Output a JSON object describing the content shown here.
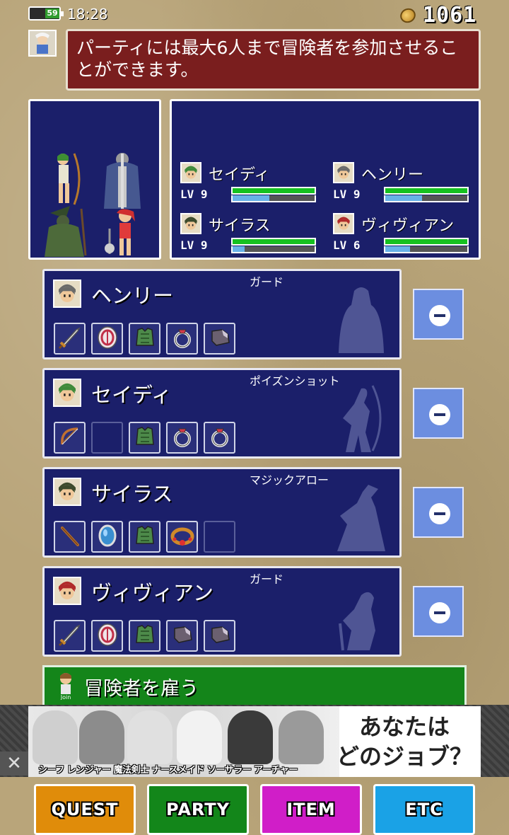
{
  "status_bar": {
    "battery": "59",
    "time": "18:28",
    "gold": "1061"
  },
  "message": "パーティには最大6人まで冒険者を参加させることができます。",
  "party_stats": [
    {
      "name": "セイディ",
      "level": "LV 9",
      "hp": 1.0,
      "exp": 0.45,
      "color": "#3f8a3a"
    },
    {
      "name": "ヘンリー",
      "level": "LV 9",
      "hp": 1.0,
      "exp": 0.45,
      "color": "#6a6a6a"
    },
    {
      "name": "サイラス",
      "level": "LV 9",
      "hp": 1.0,
      "exp": 0.15,
      "color": "#3c4a2c"
    },
    {
      "name": "ヴィヴィアン",
      "level": "LV 6",
      "hp": 1.0,
      "exp": 0.3,
      "color": "#b02a2a"
    }
  ],
  "members": [
    {
      "name": "ヘンリー",
      "skill": "ガード",
      "face_color": "#6a6a6a",
      "equipment": [
        "sword-icon",
        "shield-icon",
        "armor-icon",
        "ring-icon",
        "boots-icon"
      ]
    },
    {
      "name": "セイディ",
      "skill": "ポイズンショット",
      "face_color": "#3f8a3a",
      "equipment": [
        "bow-icon",
        "empty",
        "armor-icon",
        "ring-icon",
        "ring-icon"
      ]
    },
    {
      "name": "サイラス",
      "skill": "マジックアロー",
      "face_color": "#3c4a2c",
      "equipment": [
        "staff-icon",
        "gem-icon",
        "armor-icon",
        "bracelet-icon",
        "empty"
      ]
    },
    {
      "name": "ヴィヴィアン",
      "skill": "ガード",
      "face_color": "#b02a2a",
      "equipment": [
        "sword-icon",
        "shield-icon",
        "armor-icon",
        "boots-icon",
        "boots-icon"
      ]
    }
  ],
  "hire_button": "冒険者を雇う",
  "ad": {
    "headline_line1": "あなたは",
    "headline_line2": "どのジョブ？",
    "classes": "シーフ レンジャー 魔法剣士 ナースメイド ソーサラー アーチャー",
    "close": "✕"
  },
  "nav": [
    {
      "label": "QUEST",
      "color": "#e08c0a"
    },
    {
      "label": "PARTY",
      "color": "#13861a"
    },
    {
      "label": "ITEM",
      "color": "#d01ec8"
    },
    {
      "label": "ETC",
      "color": "#1aa2e6"
    }
  ]
}
